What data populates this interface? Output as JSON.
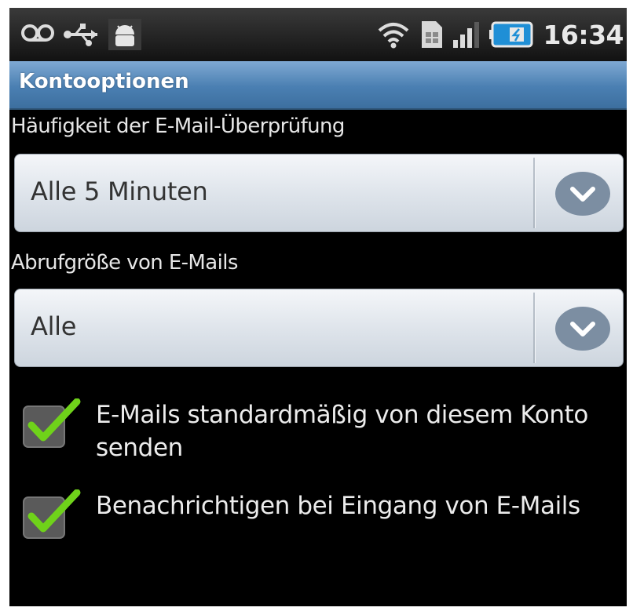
{
  "status_bar": {
    "time": "16:34",
    "left_icons": [
      "voicemail-icon",
      "usb-icon",
      "android-debug-icon"
    ],
    "right_icons": [
      "wifi-icon",
      "sim-card-icon",
      "signal-icon",
      "battery-icon"
    ]
  },
  "header": {
    "title": "Kontooptionen"
  },
  "settings": {
    "check_frequency": {
      "label": "Häufigkeit der E-Mail-Überprüfung",
      "value": "Alle 5 Minuten"
    },
    "retrieval_size": {
      "label": "Abrufgröße von E-Mails",
      "value": "Alle"
    },
    "checkboxes": [
      {
        "label": "E-Mails standardmäßig von diesem Konto senden",
        "checked": true
      },
      {
        "label": "Benachrichtigen bei Eingang von E-Mails",
        "checked": true
      }
    ]
  },
  "colors": {
    "title_bar": "#4a7fb2",
    "check_green": "#6fd21a",
    "background": "#000000"
  }
}
